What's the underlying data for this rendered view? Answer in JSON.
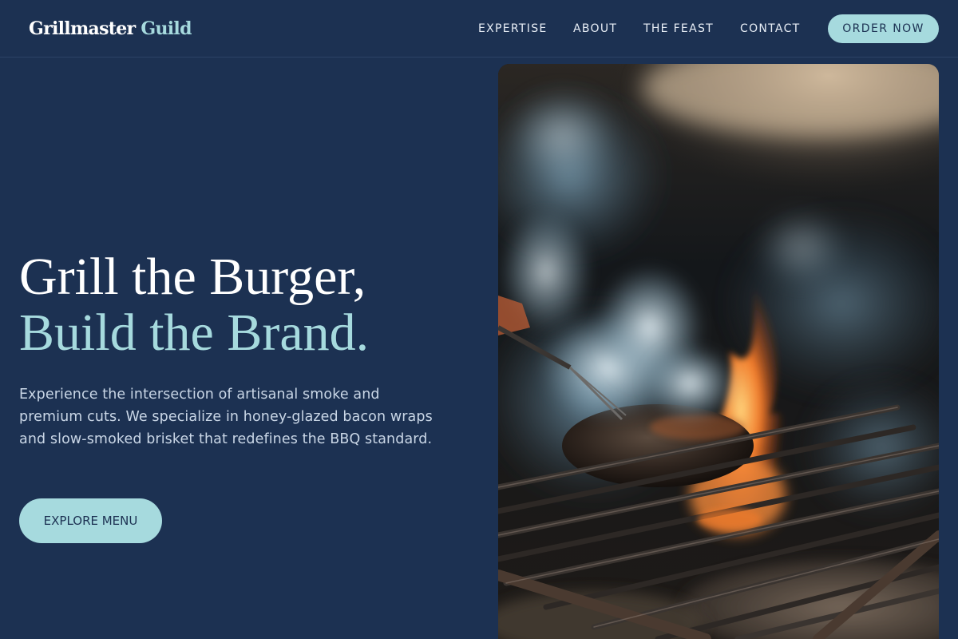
{
  "brand": {
    "name_part1": "Grillmaster",
    "name_part2": "Guild"
  },
  "nav": {
    "links": [
      {
        "label": "EXPERTISE"
      },
      {
        "label": "ABOUT"
      },
      {
        "label": "THE FEAST"
      },
      {
        "label": "CONTACT"
      }
    ],
    "cta_label": "ORDER NOW"
  },
  "hero": {
    "title_line1": "Grill the Burger,",
    "title_line2": "Build the Brand.",
    "description": "Experience the intersection of artisanal smoke and premium cuts. We specialize in honey-glazed bacon wraps and slow-smoked brisket that redefines the BBQ standard.",
    "cta_label": "EXPLORE MENU"
  },
  "colors": {
    "background": "#1c3152",
    "accent": "#a6dade",
    "text_primary": "#ffffff",
    "text_secondary": "#c9d6e6"
  }
}
